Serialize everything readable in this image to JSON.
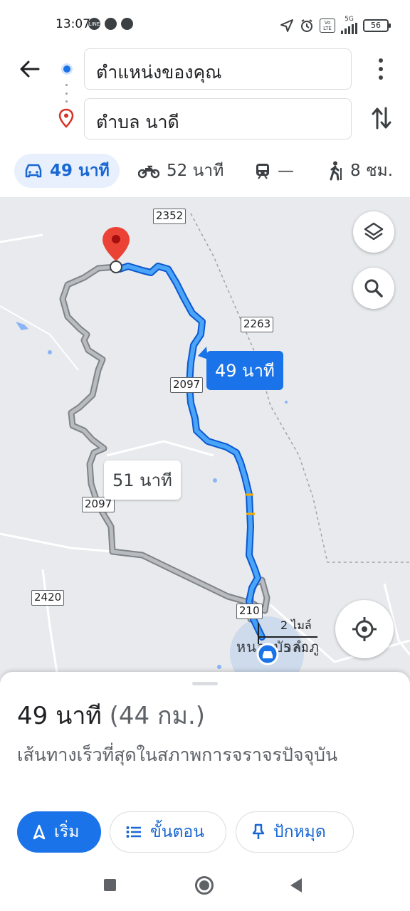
{
  "status_bar": {
    "time": "13:07",
    "network": "5G",
    "volte": "Vo LTE",
    "battery": "56",
    "icons": [
      "line-icon",
      "chrome-icon",
      "chrome-icon",
      "location-arrow-icon",
      "alarm-icon",
      "volte-icon",
      "signal-icon",
      "battery-icon"
    ]
  },
  "route": {
    "from": "ตำแหน่งของคุณ",
    "to": "ตำบล นาดี"
  },
  "modes": [
    {
      "name": "drive",
      "label": "49 นาที",
      "active": true
    },
    {
      "name": "motorcycle",
      "label": "52 นาที",
      "active": false
    },
    {
      "name": "transit",
      "label": "—",
      "active": false
    },
    {
      "name": "walk",
      "label": "8 ชม.",
      "active": false
    }
  ],
  "map": {
    "road_labels": [
      "2352",
      "2263",
      "2097",
      "2097",
      "2420",
      "210"
    ],
    "primary_route_time": "49 นาที",
    "alt_route_time": "51 นาที",
    "scale_miles": "2 ไมล์",
    "scale_km": "5 กม.",
    "place_label": "หนองบัวลำภู",
    "colors": {
      "primary_route": "#1a73e8",
      "alt_route": "#9aa0a6",
      "destination_pin": "#ea4335"
    }
  },
  "sheet": {
    "summary_time": "49 นาที",
    "summary_distance": "(44 กม.)",
    "description": "เส้นทางเร็วที่สุดในสภาพการจราจรปัจจุบัน",
    "start_label": "เริ่ม",
    "steps_label": "ขั้นตอน",
    "pin_label": "ปักหมุด"
  }
}
